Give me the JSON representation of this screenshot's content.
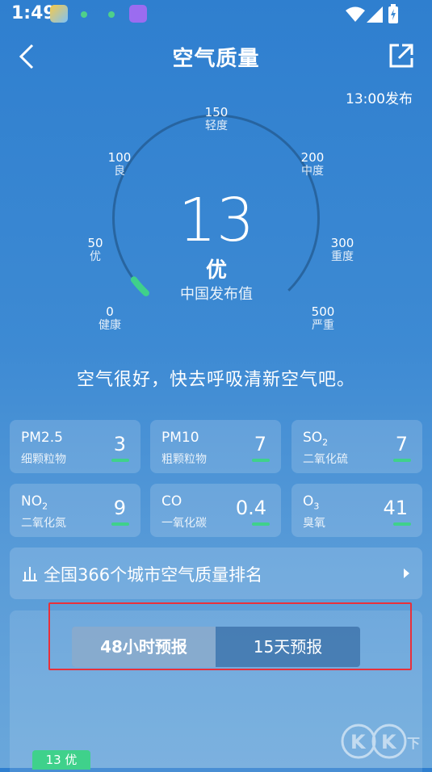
{
  "status_bar": {
    "time": "1:49"
  },
  "header": {
    "title": "空气质量",
    "publish_time": "13:00发布"
  },
  "gauge": {
    "value": "13",
    "level": "优",
    "source": "中国发布值",
    "fraction": 0.026,
    "ticks": [
      {
        "value": "0",
        "label": "健康"
      },
      {
        "value": "50",
        "label": "优"
      },
      {
        "value": "100",
        "label": "良"
      },
      {
        "value": "150",
        "label": "轻度"
      },
      {
        "value": "200",
        "label": "中度"
      },
      {
        "value": "300",
        "label": "重度"
      },
      {
        "value": "500",
        "label": "严重"
      }
    ],
    "accent": "#3fd18b"
  },
  "message": "空气很好，快去呼吸清新空气吧。",
  "pollutants": [
    {
      "name": "PM2.5",
      "sub": "",
      "desc": "细颗粒物",
      "value": "3"
    },
    {
      "name": "PM10",
      "sub": "",
      "desc": "粗颗粒物",
      "value": "7"
    },
    {
      "name": "SO",
      "sub": "2",
      "desc": "二氧化硫",
      "value": "7"
    },
    {
      "name": "NO",
      "sub": "2",
      "desc": "二氧化氮",
      "value": "9"
    },
    {
      "name": "CO",
      "sub": "",
      "desc": "一氧化碳",
      "value": "0.4"
    },
    {
      "name": "O",
      "sub": "3",
      "desc": "臭氧",
      "value": "41"
    }
  ],
  "ranking": {
    "label": "全国366个城市空气质量排名"
  },
  "forecast": {
    "tabs": [
      {
        "label": "48小时预报"
      },
      {
        "label": "15天预报"
      }
    ],
    "first_badge": "13 优"
  },
  "watermark": "KK下载"
}
